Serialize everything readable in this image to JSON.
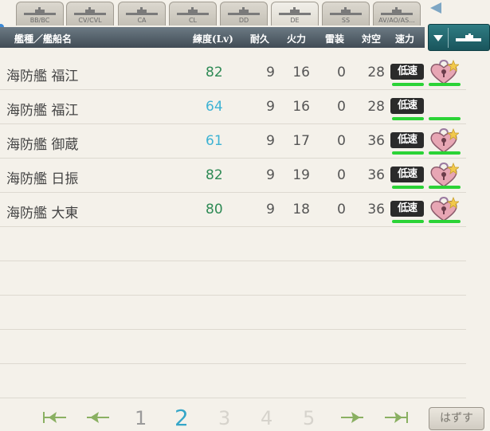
{
  "tabs": [
    {
      "label": "BB/BC",
      "active": false
    },
    {
      "label": "CV/CVL",
      "active": false
    },
    {
      "label": "CA",
      "active": false
    },
    {
      "label": "CL",
      "active": false
    },
    {
      "label": "DD",
      "active": false
    },
    {
      "label": "DE",
      "active": true
    },
    {
      "label": "SS",
      "active": false
    },
    {
      "label": "AV/AO/AS...",
      "active": false
    }
  ],
  "header": {
    "col_name": "艦種／艦船名",
    "col_level": "練度(Lv)",
    "col_hp": "耐久",
    "col_firepower": "火力",
    "col_torpedo": "雷装",
    "col_aa": "対空",
    "col_speed": "速力"
  },
  "ships": [
    {
      "name": "海防艦 福江",
      "level": "82",
      "level_color": "#2e8a55",
      "hp": "9",
      "firepower": "16",
      "torpedo": "0",
      "aa": "28",
      "speed": "低速",
      "locked": true
    },
    {
      "name": "海防艦 福江",
      "level": "64",
      "level_color": "#3eb3d4",
      "hp": "9",
      "firepower": "16",
      "torpedo": "0",
      "aa": "28",
      "speed": "低速",
      "locked": false
    },
    {
      "name": "海防艦 御蔵",
      "level": "61",
      "level_color": "#3eb3d4",
      "hp": "9",
      "firepower": "17",
      "torpedo": "0",
      "aa": "36",
      "speed": "低速",
      "locked": true
    },
    {
      "name": "海防艦 日振",
      "level": "82",
      "level_color": "#2e8a55",
      "hp": "9",
      "firepower": "19",
      "torpedo": "0",
      "aa": "36",
      "speed": "低速",
      "locked": true
    },
    {
      "name": "海防艦 大東",
      "level": "80",
      "level_color": "#2e8a55",
      "hp": "9",
      "firepower": "18",
      "torpedo": "0",
      "aa": "36",
      "speed": "低速",
      "locked": true
    }
  ],
  "pager": {
    "pages": [
      "1",
      "2",
      "3",
      "4",
      "5"
    ],
    "current": "2"
  },
  "remove_label": "はずす",
  "colors": {
    "header_bg": "#4f5b64",
    "level_high": "#2e8a55",
    "level_low": "#3eb3d4",
    "bar_green": "#2bd336",
    "sort_button": "#23666d",
    "lock_pink": "#e7a6b4"
  },
  "icons": {
    "sort_dropdown": "chevron-down-icon",
    "ship_type": "ship-icon",
    "lock": "heart-lock-icon",
    "first_page": "first-page-icon",
    "prev_page": "prev-page-icon",
    "next_page": "next-page-icon",
    "last_page": "last-page-icon",
    "tab_back": "triangle-left-icon"
  }
}
